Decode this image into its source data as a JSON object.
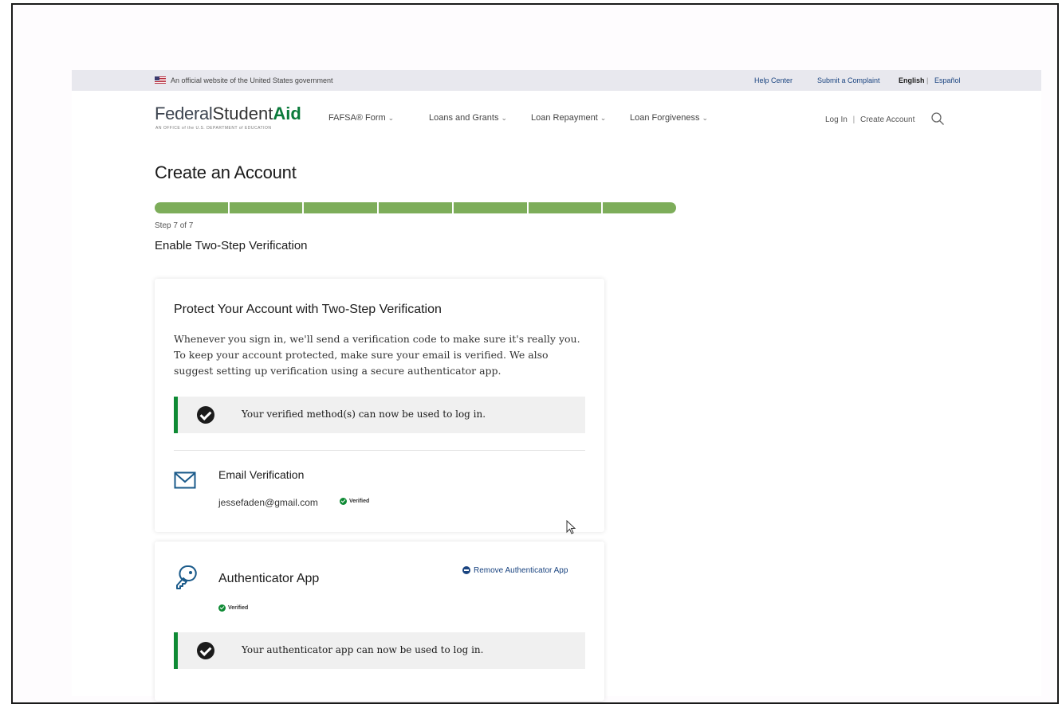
{
  "gov_banner": {
    "official_text": "An official website of the United States government",
    "help_center": "Help Center",
    "submit_complaint": "Submit a Complaint",
    "english": "English",
    "separator": "|",
    "espanol": "Español"
  },
  "header": {
    "logo_part1": "Federal",
    "logo_part2": "Student",
    "logo_part3": "Aid",
    "logo_tagline": "AN OFFICE of the U.S. DEPARTMENT of EDUCATION",
    "nav": [
      {
        "label": "FAFSA® Form"
      },
      {
        "label": "Loans and Grants"
      },
      {
        "label": "Loan Repayment"
      },
      {
        "label": "Loan Forgiveness"
      }
    ],
    "log_in": "Log In",
    "create_account": "Create Account",
    "account_separator": "|",
    "search_icon": "search-icon"
  },
  "page": {
    "title": "Create an Account",
    "progress": {
      "current_step": 7,
      "total_steps": 7,
      "completed_fraction": 1.0
    },
    "step_label": "Step 7 of 7",
    "step_heading": "Enable Two-Step Verification"
  },
  "protect_card": {
    "heading": "Protect Your Account with Two-Step Verification",
    "description": "Whenever you sign in, we'll send a verification code to make sure it's really you. To keep your account protected, make sure your email is verified. We also suggest setting up verification using a secure authenticator app.",
    "alert_message": "Your verified method(s) can now be used to log in.",
    "email_verification": {
      "title": "Email Verification",
      "email": "jessefaden@gmail.com",
      "badge": "Verified",
      "icon": "envelope-icon"
    }
  },
  "authenticator_card": {
    "title": "Authenticator App",
    "remove_link": "Remove Authenticator App",
    "badge": "Verified",
    "alert_message": "Your authenticator app can now be used to log in.",
    "icon": "key-icon"
  },
  "colors": {
    "brand_green": "#0b7a3b",
    "progress_green": "#7dad5a",
    "success_green": "#0e8a34",
    "link_blue": "#1a4480"
  }
}
